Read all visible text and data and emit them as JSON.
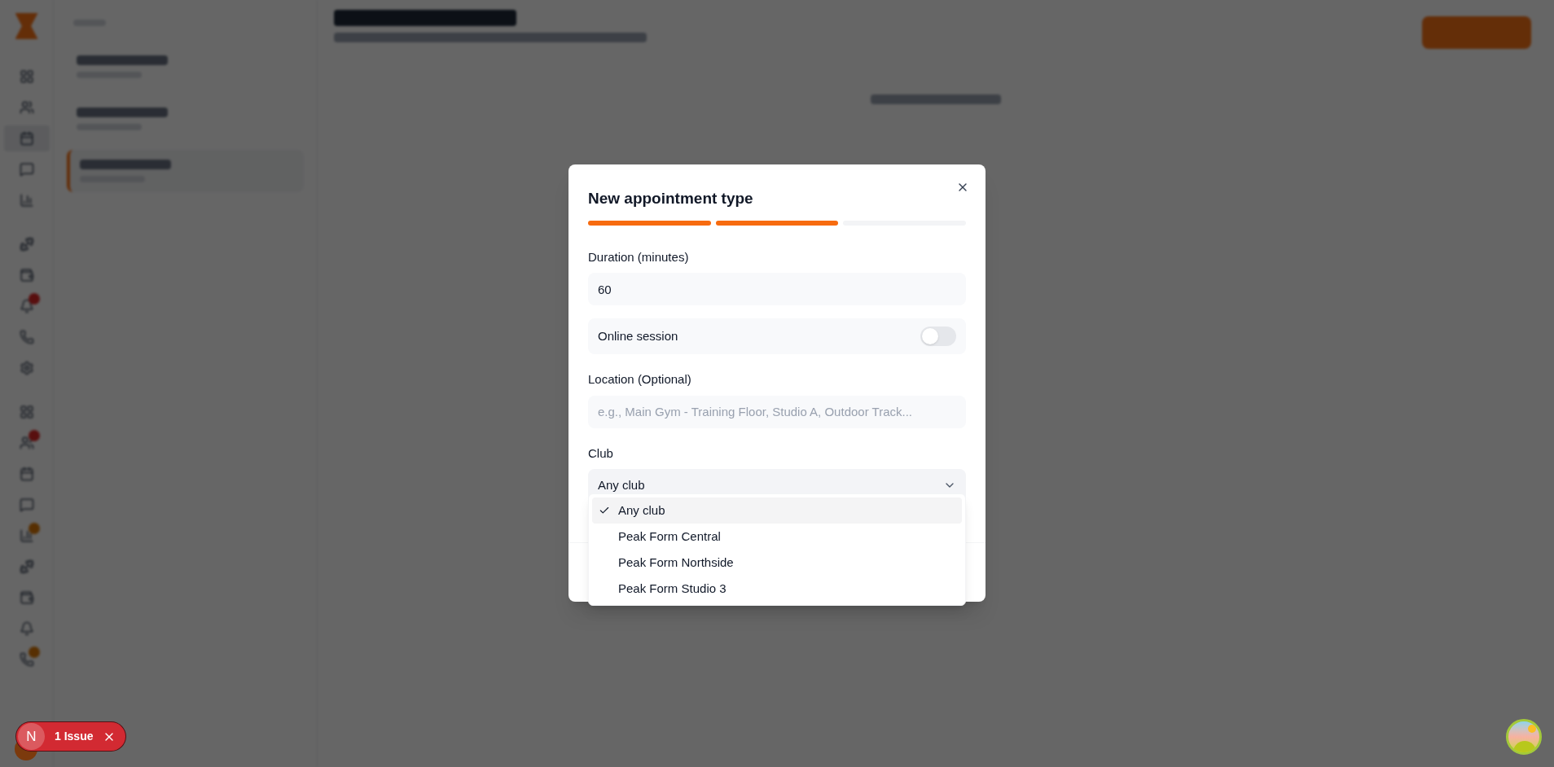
{
  "dialog": {
    "title": "New appointment type",
    "steps": [
      {
        "done": true
      },
      {
        "done": true
      },
      {
        "done": false
      }
    ],
    "duration": {
      "label": "Duration (minutes)",
      "value": "60"
    },
    "online": {
      "label": "Online session",
      "on": false
    },
    "location": {
      "label": "Location (Optional)",
      "placeholder": "e.g., Main Gym - Training Floor, Studio A, Outdoor Track..."
    },
    "club": {
      "label": "Club",
      "value": "Any club",
      "expanded": true,
      "options": [
        {
          "label": "Any club",
          "selected": true
        },
        {
          "label": "Peak Form Central",
          "selected": false
        },
        {
          "label": "Peak Form Northside",
          "selected": false
        },
        {
          "label": "Peak Form Studio 3",
          "selected": false
        }
      ]
    }
  },
  "issues": {
    "avatar": "N",
    "label": "1 Issue"
  }
}
